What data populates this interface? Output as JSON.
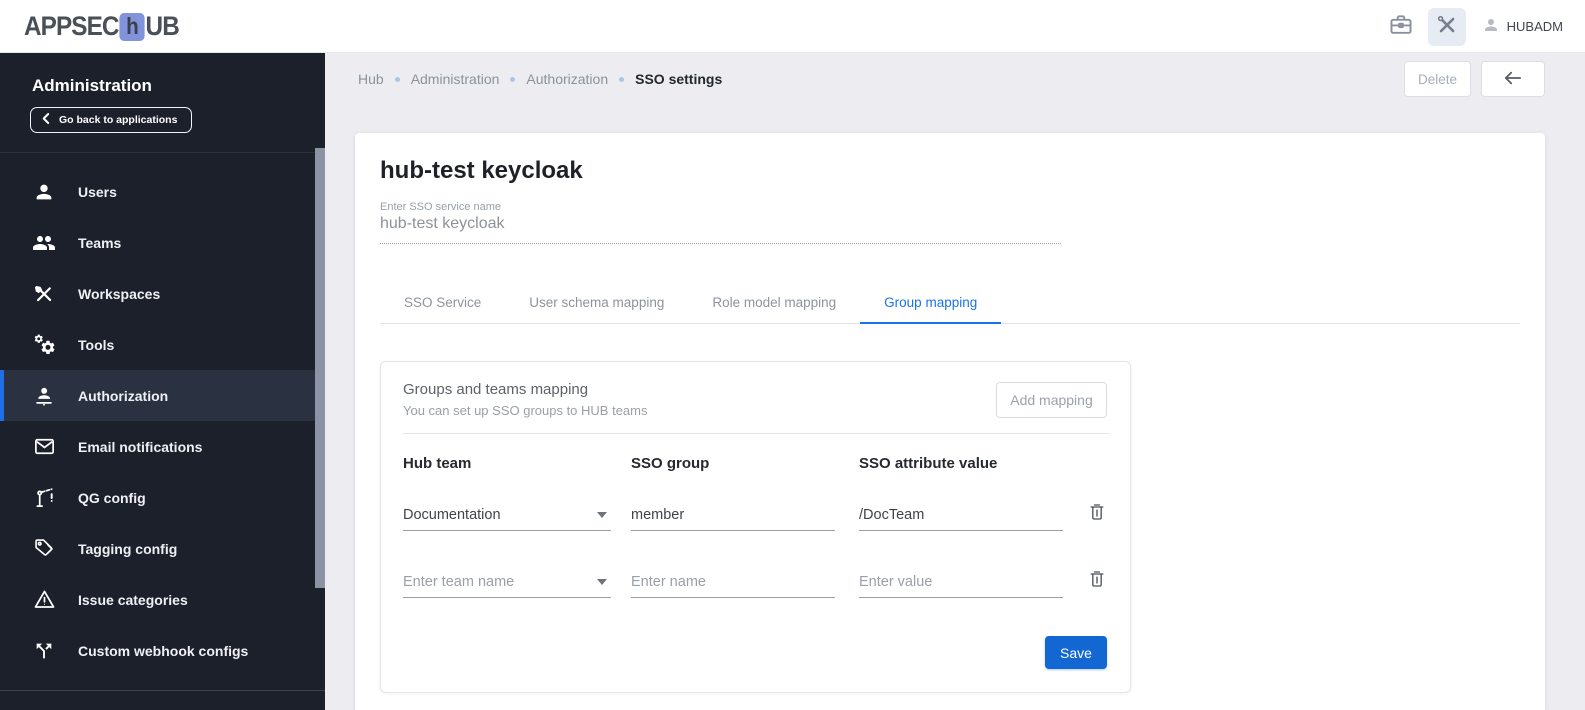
{
  "header": {
    "logo": {
      "part1": "APPSEC",
      "accent_letter": "h",
      "part2": "UB"
    },
    "user_name": "HUBADM",
    "icons": [
      "toolbox-icon",
      "admin-tools-icon",
      "user-avatar-icon"
    ]
  },
  "page_toolbar": {
    "delete_label": "Delete",
    "back_icon": "arrow-left-icon"
  },
  "breadcrumb": {
    "items": [
      "Hub",
      "Administration",
      "Authorization",
      "SSO settings"
    ]
  },
  "sidebar": {
    "title": "Administration",
    "back_button_label": "Go back to applications",
    "items": [
      {
        "label": "Users",
        "icon": "user-icon",
        "active": false
      },
      {
        "label": "Teams",
        "icon": "teams-icon",
        "active": false
      },
      {
        "label": "Workspaces",
        "icon": "workspaces-icon",
        "active": false
      },
      {
        "label": "Tools",
        "icon": "tools-icon",
        "active": false
      },
      {
        "label": "Authorization",
        "icon": "authorization-icon",
        "active": true
      },
      {
        "label": "Email notifications",
        "icon": "email-icon",
        "active": false
      },
      {
        "label": "QG config",
        "icon": "qg-config-icon",
        "active": false
      },
      {
        "label": "Tagging config",
        "icon": "tag-icon",
        "active": false
      },
      {
        "label": "Issue categories",
        "icon": "warning-icon",
        "active": false
      },
      {
        "label": "Custom webhook configs",
        "icon": "webhook-icon",
        "active": false
      }
    ]
  },
  "main": {
    "title": "hub-test keycloak",
    "sso_name_field": {
      "label": "Enter SSO service name",
      "value": "hub-test keycloak"
    },
    "tabs": [
      {
        "label": "SSO Service",
        "active": false
      },
      {
        "label": "User schema mapping",
        "active": false
      },
      {
        "label": "Role model mapping",
        "active": false
      },
      {
        "label": "Group mapping",
        "active": true
      }
    ],
    "mapping_card": {
      "title": "Groups and teams mapping",
      "subtitle": "You can set up SSO groups to HUB teams",
      "add_button_label": "Add mapping",
      "columns": [
        "Hub team",
        "SSO group",
        "SSO attribute value"
      ],
      "rows": [
        {
          "hub_team": "Documentation",
          "sso_group": "member",
          "sso_attribute_value": "/DocTeam"
        },
        {
          "hub_team_placeholder": "Enter team name",
          "sso_group_placeholder": "Enter name",
          "sso_attribute_value_placeholder": "Enter value"
        }
      ],
      "save_button_label": "Save"
    }
  },
  "colors": {
    "accent_blue": "#1a73e8",
    "save_button_blue": "#1267d2",
    "sidebar_background": "#1b202b",
    "sidebar_active_background": "#2a3140",
    "sidebar_active_border": "#1f6fe8",
    "logo_accent": "#8193da",
    "page_background": "#ededf1",
    "breadcrumb_dot": "#a9c6ec"
  }
}
